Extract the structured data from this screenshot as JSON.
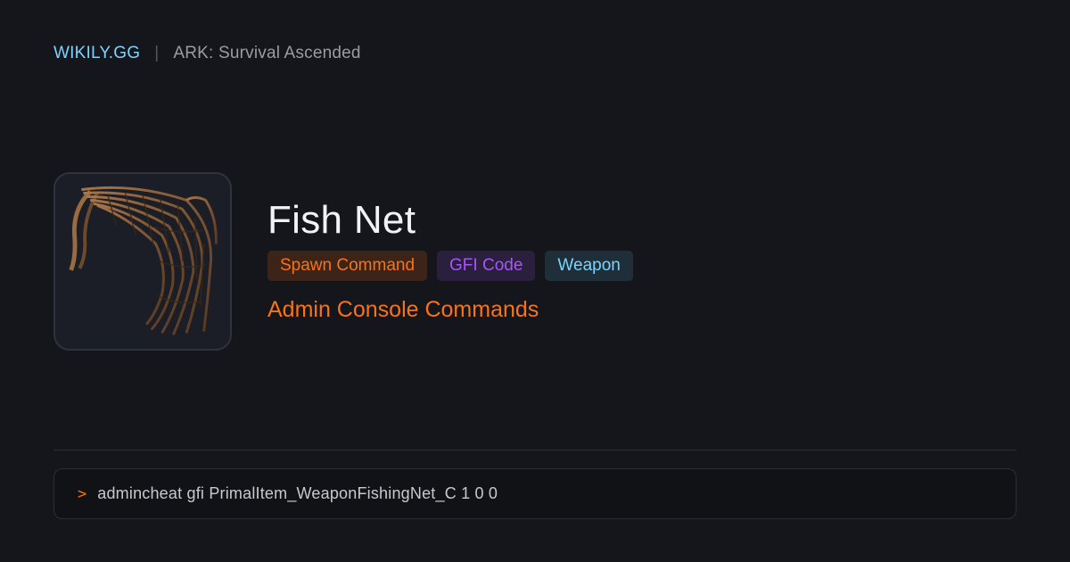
{
  "header": {
    "brand": "WIKILY.GG",
    "separator": "|",
    "game": "ARK: Survival Ascended"
  },
  "item": {
    "name": "Fish Net",
    "image_alt": "Fish Net",
    "tags": [
      {
        "label": "Spawn Command",
        "color": "#f97316"
      },
      {
        "label": "GFI Code",
        "color": "#a855f7"
      },
      {
        "label": "Weapon",
        "color": "#7dd3fc"
      }
    ],
    "subtitle": "Admin Console Commands"
  },
  "console": {
    "prompt": ">",
    "command": "admincheat gfi PrimalItem_WeaponFishingNet_C 1 0 0"
  },
  "colors": {
    "background": "#15161b",
    "accent_orange": "#f97316",
    "accent_purple": "#a855f7",
    "accent_cyan": "#7dd3fc"
  }
}
